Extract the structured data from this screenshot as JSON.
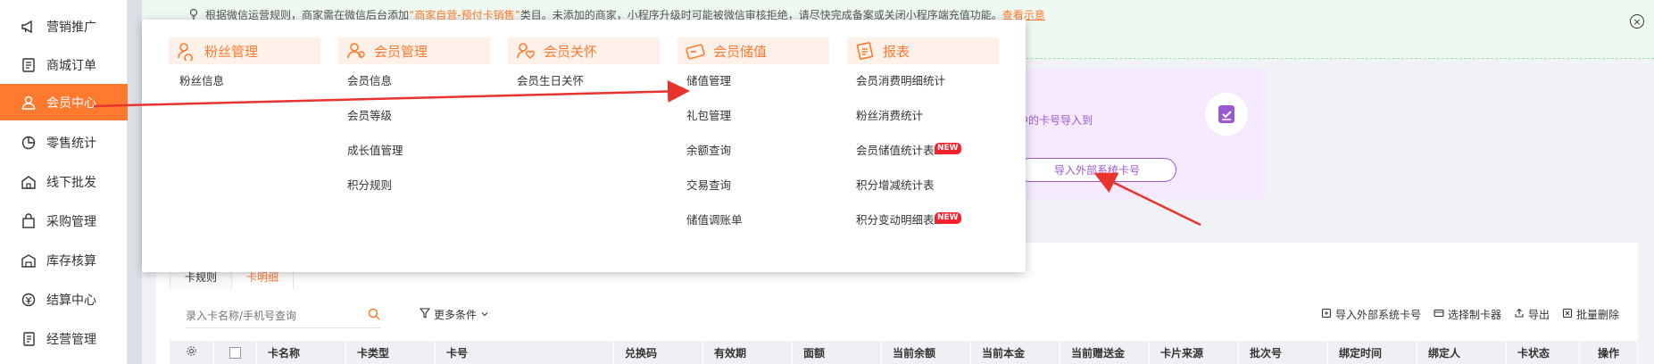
{
  "sidebar": {
    "items": [
      {
        "label": "营销推广",
        "icon": "megaphone-icon"
      },
      {
        "label": "商城订单",
        "icon": "order-icon"
      },
      {
        "label": "会员中心",
        "icon": "member-icon",
        "active": true
      },
      {
        "label": "零售统计",
        "icon": "stats-icon"
      },
      {
        "label": "线下批发",
        "icon": "wholesale-icon"
      },
      {
        "label": "采购管理",
        "icon": "bag-icon"
      },
      {
        "label": "库存核算",
        "icon": "warehouse-icon"
      },
      {
        "label": "结算中心",
        "icon": "settlement-icon"
      },
      {
        "label": "经营管理",
        "icon": "doc-icon"
      }
    ]
  },
  "notice": {
    "prefix": "根据微信运营规则，商家需在微信后台添加",
    "highlight": "“商家自营-预付卡销售”",
    "suffix": "类目。未添加的商家，小程序升级时可能被微信审核拒绝，请尽快完成备案或关闭小程序端充值功能。",
    "link": "查看示意",
    "close": "×"
  },
  "promo": {
    "text": "中的卡号导入到",
    "button": "导入外部系统卡号"
  },
  "menu": {
    "columns": [
      {
        "title": "粉丝管理",
        "items": [
          "粉丝信息"
        ]
      },
      {
        "title": "会员管理",
        "items": [
          "会员信息",
          "会员等级",
          "成长值管理",
          "积分规则"
        ]
      },
      {
        "title": "会员关怀",
        "items": [
          "会员生日关怀"
        ]
      },
      {
        "title": "会员储值",
        "items": [
          "储值管理",
          "礼包管理",
          "余额查询",
          "交易查询",
          "储值调账单"
        ]
      },
      {
        "title": "报表",
        "items": [
          "会员消费明细统计",
          "粉丝消费统计",
          "会员储值统计表",
          "积分增减统计表",
          "积分变动明细表"
        ]
      }
    ],
    "new_badge": "NEW"
  },
  "tabs": [
    "卡规则",
    "卡明细"
  ],
  "search": {
    "placeholder": "录入卡名称/手机号查询"
  },
  "more_conditions": "更多条件",
  "actions": [
    "导入外部系统卡号",
    "选择制卡器",
    "导出",
    "批量删除"
  ],
  "table": {
    "columns": [
      "卡名称",
      "卡类型",
      "卡号",
      "兑换码",
      "有效期",
      "面额",
      "当前余额",
      "当前本金",
      "当前赠送金",
      "卡片来源",
      "批次号",
      "绑定时间",
      "绑定人",
      "卡状态",
      "操作"
    ]
  },
  "colors": {
    "accent": "#ff7a2f",
    "purple": "#9b59d0",
    "arrow": "#e8332f"
  }
}
